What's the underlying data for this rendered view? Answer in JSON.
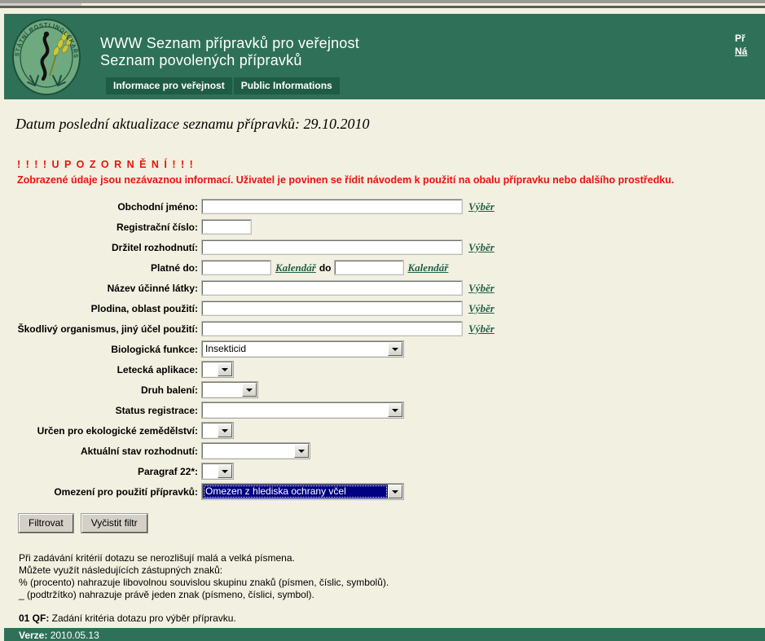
{
  "header": {
    "title_line1": "WWW Seznam přípravků pro veřejnost",
    "title_line2": "Seznam povolených přípravků",
    "logo_text": "STÁTNÍ ROSTLINOLÉKAŘSKÁ SPRÁVA",
    "links": [
      {
        "label": "Př",
        "underlined": false
      },
      {
        "label": "Ná",
        "underlined": true
      }
    ],
    "tabs": [
      {
        "label": "Informace pro veřejnost"
      },
      {
        "label": "Public Informations"
      }
    ]
  },
  "page": {
    "update_line": "Datum poslední aktualizace seznamu přípravků: 29.10.2010",
    "warning_title": "! ! ! ! U P O Z O R N Ě N Í ! ! !",
    "warning_text": "Zobrazené údaje jsou nezávaznou informací. Uživatel je povinen se řídit návodem k použití na obalu přípravku nebo dalšího prostředku."
  },
  "form": {
    "labels": {
      "obchodni_jmeno": "Obchodní jméno:",
      "registracni_cislo": "Registrační číslo:",
      "drzitel": "Držitel rozhodnutí:",
      "platne_do": "Platné do:",
      "nazev_latky": "Název účinné látky:",
      "plodina": "Plodina, oblast použití:",
      "skodlivy_organismus": "Škodlivý organismus, jiný účel použití:",
      "biologicka_funkce": "Biologická funkce:",
      "letecka_aplikace": "Letecká aplikace:",
      "druh_baleni": "Druh balení:",
      "status_registrace": "Status registrace:",
      "ekologicke": "Určen pro ekologické zemědělství:",
      "aktualni_stav": "Aktuální stav rozhodnutí:",
      "paragraf": "Paragraf 22*:",
      "omezeni": "Omezení pro použití přípravků:"
    },
    "values": {
      "obchodni_jmeno": "",
      "registracni_cislo": "",
      "drzitel": "",
      "platne_do_od": "",
      "platne_do_do": "",
      "nazev_latky": "",
      "plodina": "",
      "skodlivy_organismus": "",
      "biologicka_funkce": "Insekticid",
      "letecka_aplikace": "",
      "druh_baleni": "",
      "status_registrace": "",
      "ekologicke": "",
      "aktualni_stav": "",
      "paragraf": "",
      "omezeni": "Omezen z hlediska ochrany včel"
    },
    "select_link": "Výběr",
    "calendar_link": "Kalendář",
    "between_word": "do",
    "buttons": {
      "filter": "Filtrovat",
      "clear": "Vyčistit filtr"
    }
  },
  "help": {
    "line1": "Při zadávání kritérií dotazu se nerozlišují malá a velká písmena.",
    "line2": "Můžete využít následujících zástupných znaků:",
    "line3": "% (procento) nahrazuje libovolnou souvislou skupinu znaků (písmen, číslic, symbolů).",
    "line4": "_ (podtržítko) nahrazuje právě jeden znak (písmeno, číslici, symbol).",
    "qf_code": "01 QF:",
    "qf_text": " Zadání kritéria dotazu pro výběr přípravku."
  },
  "footer": {
    "version_label": "Verze:",
    "version_value": " 2010.05.13"
  },
  "colors": {
    "header_green": "#2E7158",
    "tab_green": "#1F5C45",
    "page_bg": "#F2F0E0",
    "warning_red": "#E8130E",
    "link_green": "#1F6148",
    "selection_navy": "#000080"
  }
}
